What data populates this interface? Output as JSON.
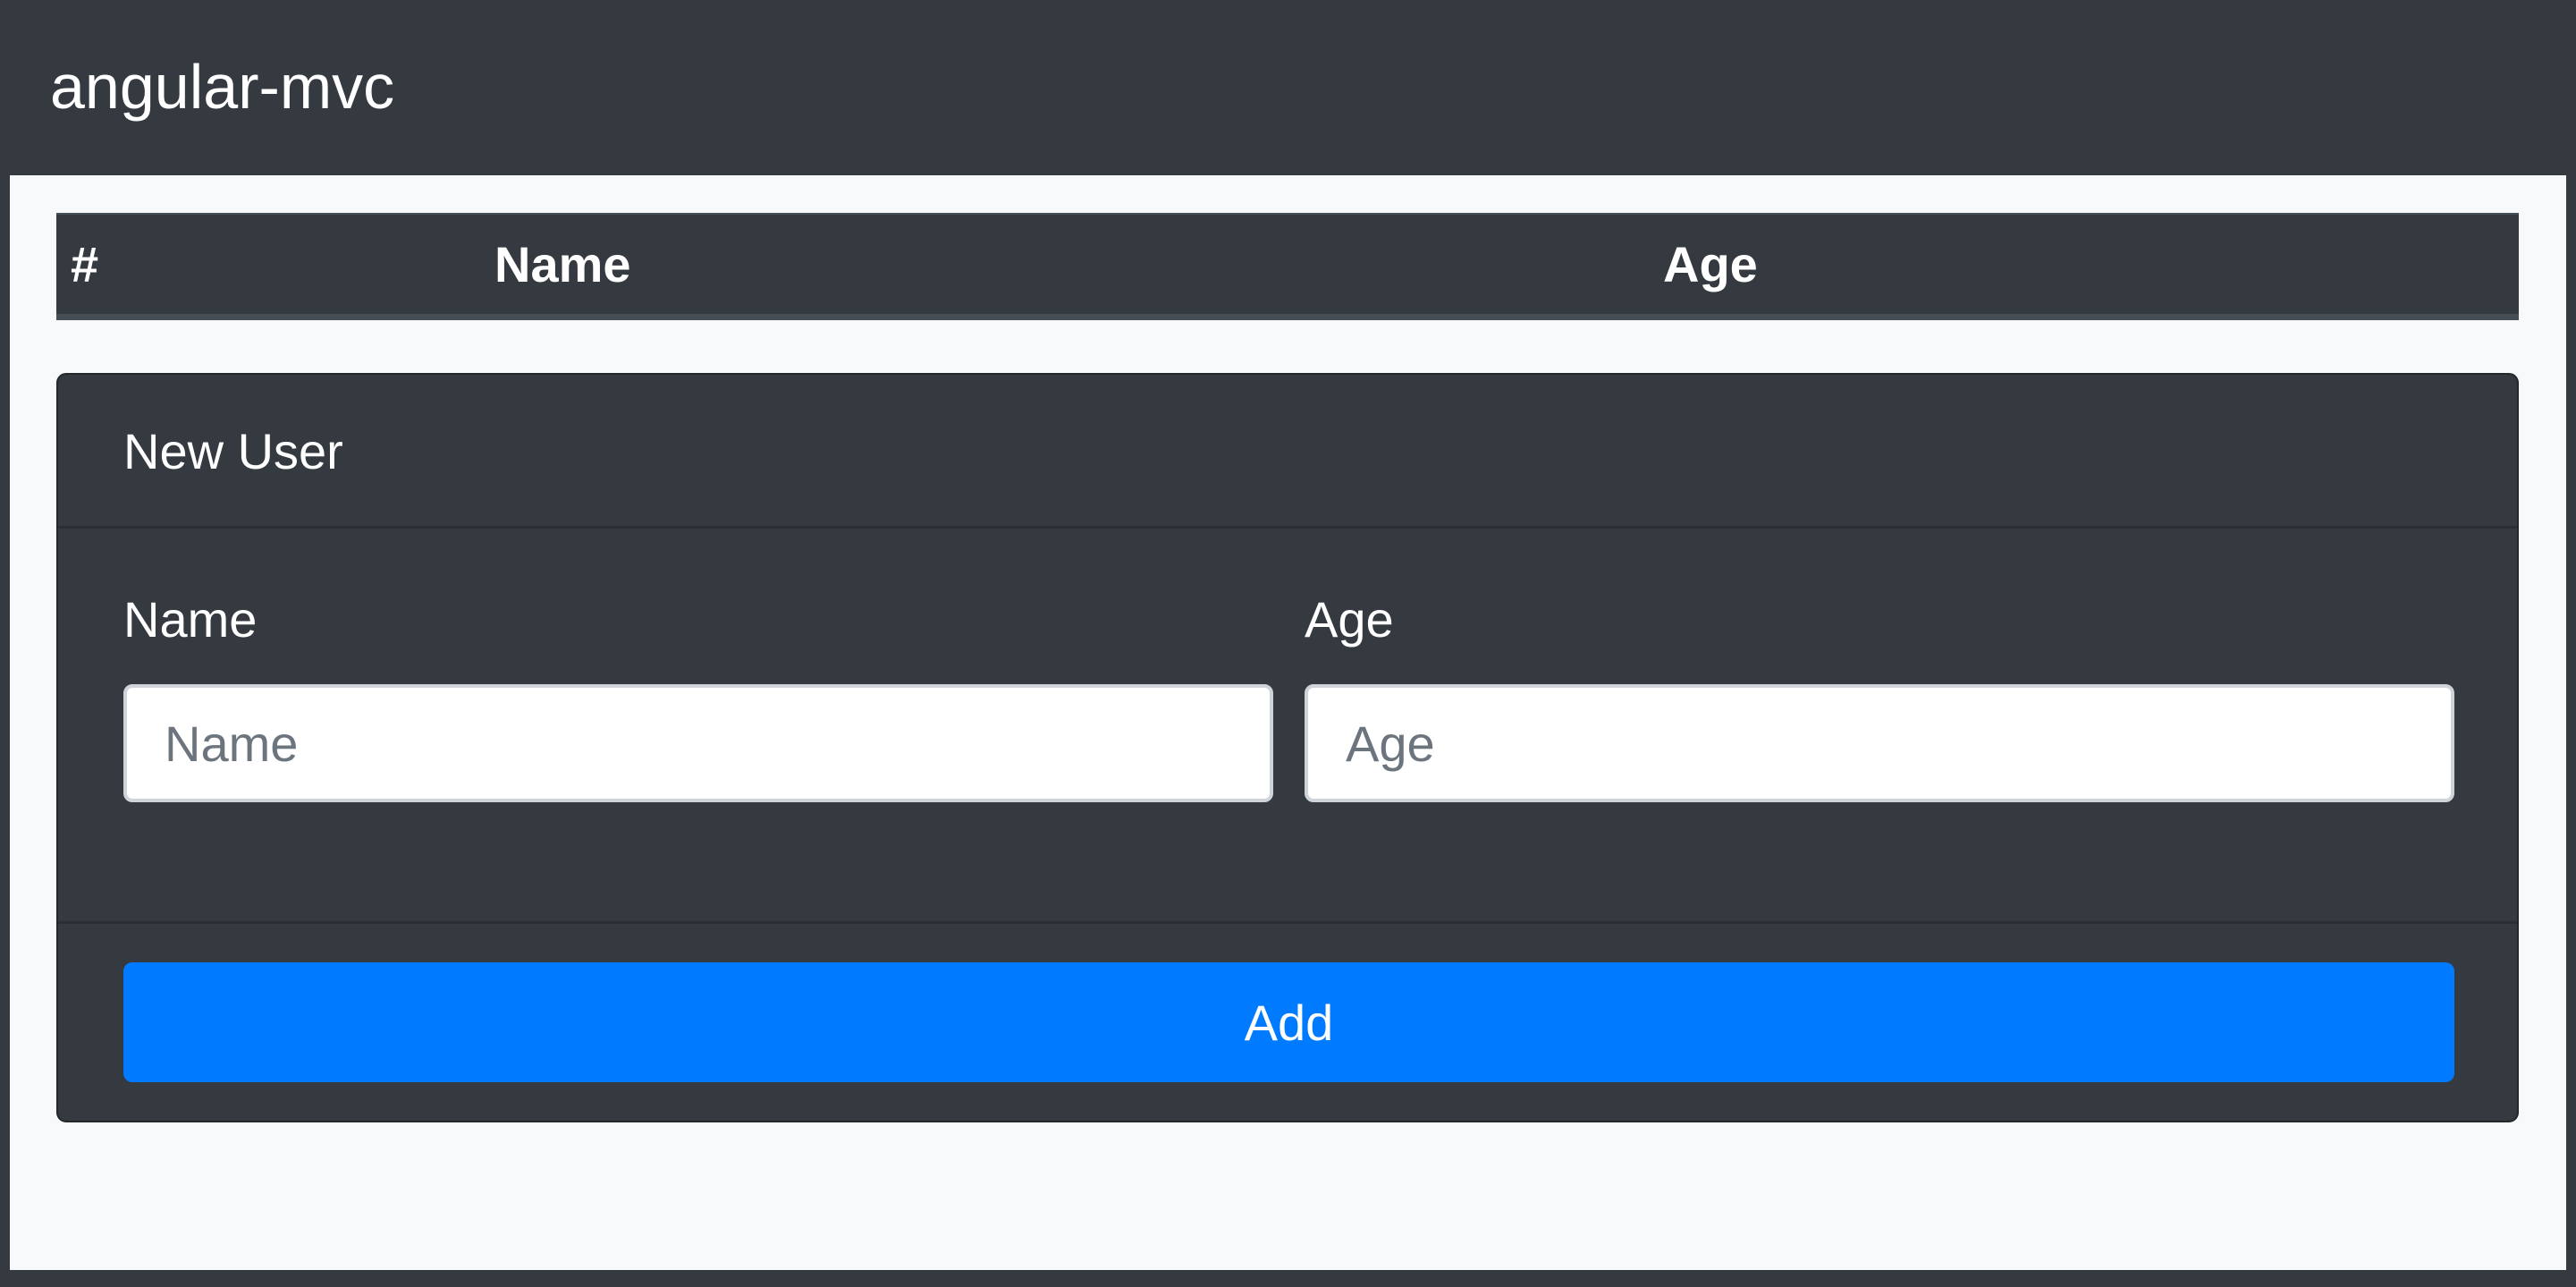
{
  "navbar": {
    "brand": "angular-mvc"
  },
  "table": {
    "columns": [
      "#",
      "Name",
      "Age"
    ],
    "rows": []
  },
  "new_user_card": {
    "title": "New User",
    "name_label": "Name",
    "name_placeholder": "Name",
    "name_value": "",
    "age_label": "Age",
    "age_placeholder": "Age",
    "age_value": "",
    "add_label": "Add"
  },
  "colors": {
    "dark": "#343a40",
    "light_bg": "#f8f9fa",
    "primary": "#007bff"
  }
}
